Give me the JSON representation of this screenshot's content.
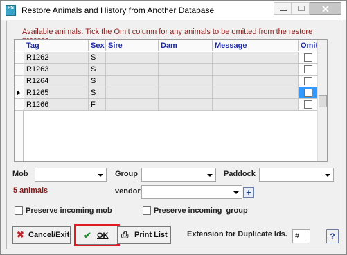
{
  "window": {
    "title": "Restore Animals and History from Another Database",
    "app_icon": "PS"
  },
  "info_text": "Available animals. Tick the Omit column for any animals to be omitted from the restore process",
  "table": {
    "columns": [
      "Tag",
      "Sex",
      "Sire",
      "Dam",
      "Message",
      "Omit"
    ],
    "rows": [
      {
        "tag": "R1262",
        "sex": "S",
        "sire": "",
        "dam": "",
        "message": "",
        "omit": false
      },
      {
        "tag": "R1263",
        "sex": "S",
        "sire": "",
        "dam": "",
        "message": "",
        "omit": false
      },
      {
        "tag": "R1264",
        "sex": "S",
        "sire": "",
        "dam": "",
        "message": "",
        "omit": false
      },
      {
        "tag": "R1265",
        "sex": "S",
        "sire": "",
        "dam": "",
        "message": "",
        "omit": false,
        "current": true
      },
      {
        "tag": "R1266",
        "sex": "F",
        "sire": "",
        "dam": "",
        "message": "",
        "omit": false
      }
    ]
  },
  "filters": {
    "mob_label": "Mob",
    "group_label": "Group",
    "paddock_label": "Paddock",
    "vendor_label": "vendor",
    "mob_value": "",
    "group_value": "",
    "paddock_value": "",
    "vendor_value": ""
  },
  "count_text": "5 animals",
  "options": {
    "preserve_mob": "Preserve incoming mob",
    "preserve_group": "Preserve incoming  group"
  },
  "buttons": {
    "cancel": "Cancel/Exit",
    "ok": "OK",
    "print": "Print List",
    "help": "?",
    "plus": "+"
  },
  "duplicate": {
    "label": "Extension for Duplicate Ids.",
    "value": "#"
  },
  "colors": {
    "accent": "#1c2aa8",
    "warning_text": "#8b1a1a",
    "selection": "#3399ff",
    "highlight": "#e01b24"
  }
}
